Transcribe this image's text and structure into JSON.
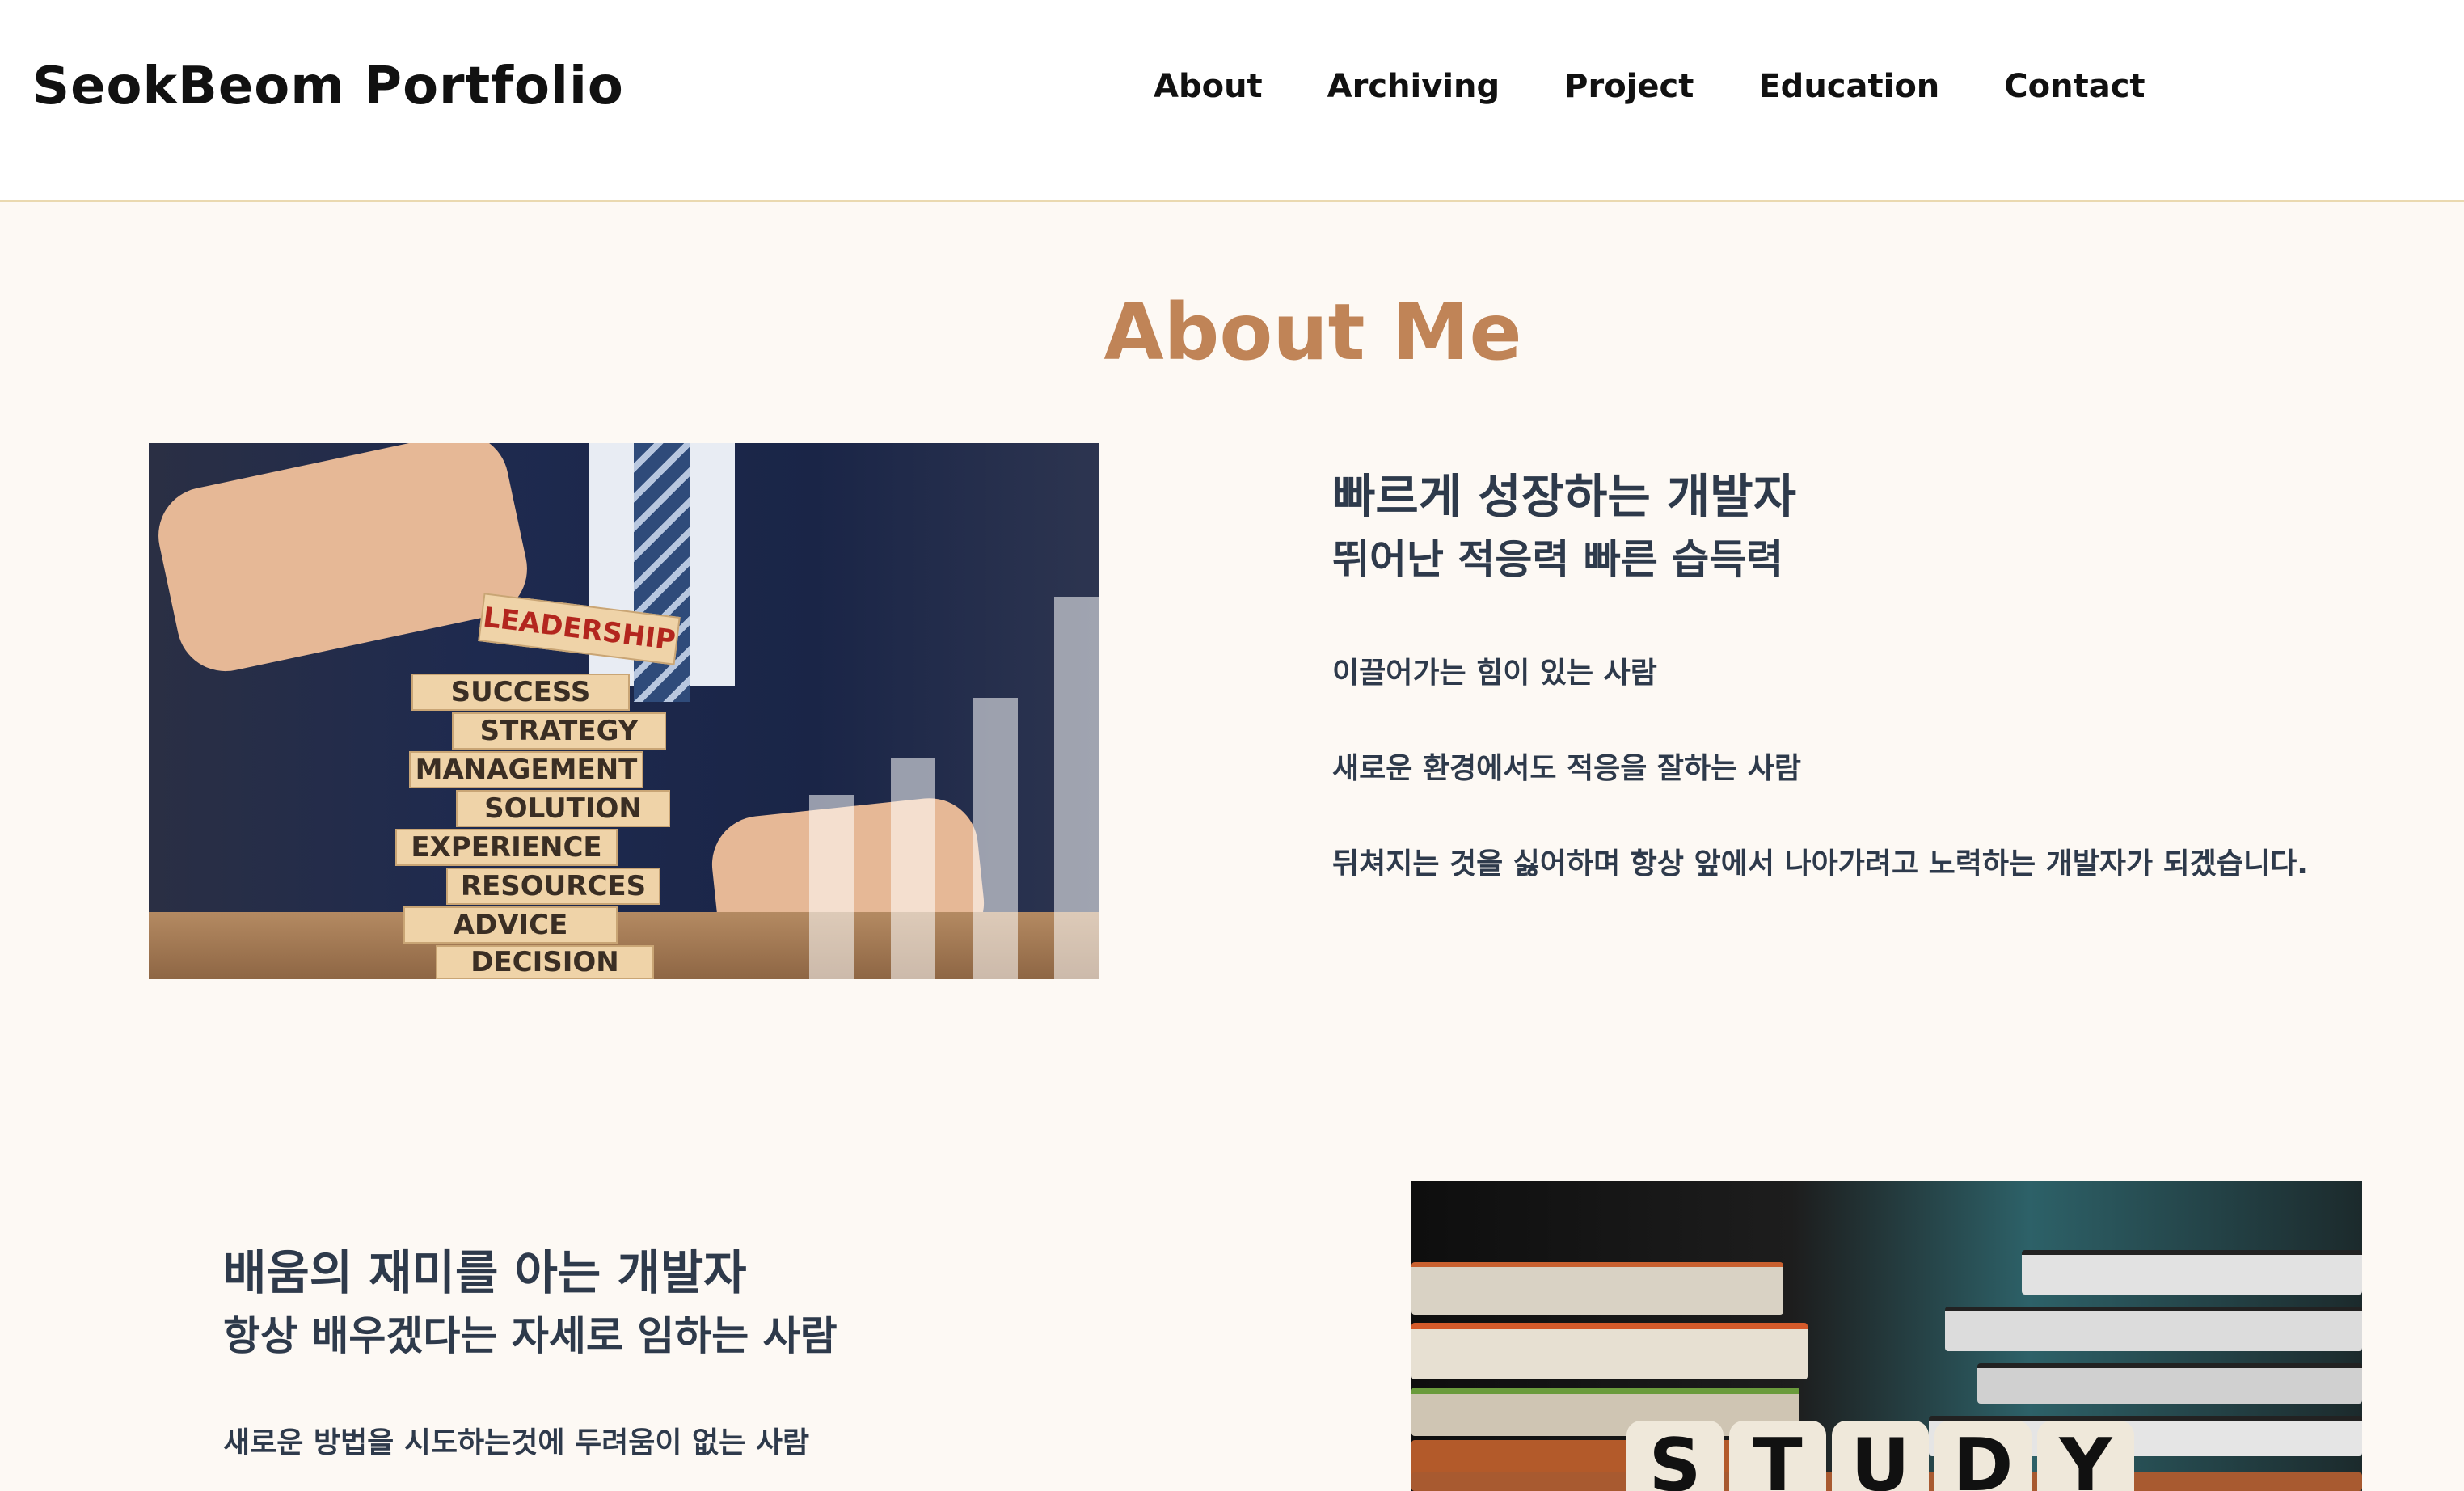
{
  "header": {
    "logo": "SeokBeom Portfolio",
    "nav": [
      "About",
      "Archiving",
      "Project",
      "Education",
      "Contact"
    ]
  },
  "about": {
    "title": "About Me",
    "block1": {
      "heading": "빠르게 성장하는 개발자",
      "subheading": "뛰어난 적응력 빠른 습득력",
      "paragraphs": [
        "이끌어가는 힘이 있는 사람",
        "새로운 환경에서도 적응을 잘하는 사람",
        "뒤쳐지는 것을 싫어하며 항상 앞에서 나아가려고 노력하는 개발자가 되겠습니다."
      ],
      "image_blocks": [
        "LEADERSHIP",
        "SUCCESS",
        "STRATEGY",
        "MANAGEMENT",
        "SOLUTION",
        "EXPERIENCE",
        "RESOURCES",
        "ADVICE",
        "DECISION"
      ]
    },
    "block2": {
      "heading": "배움의 재미를 아는 개발자",
      "subheading": "항상 배우겠다는 자세로 임하는 사람",
      "paragraphs": [
        "새로운 방법을 시도하는것에 두려움이 없는 사람"
      ],
      "image_dice": [
        "S",
        "T",
        "U",
        "D",
        "Y"
      ]
    }
  },
  "colors": {
    "accent": "#c08457",
    "text": "#2e3a4b",
    "background": "#fdf9f4",
    "header_border": "#ead9b0"
  }
}
